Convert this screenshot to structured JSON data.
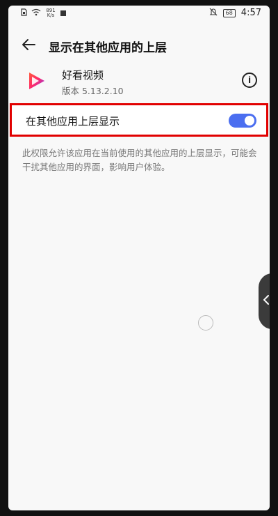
{
  "status_bar": {
    "net_speed_top": "891",
    "net_speed_bottom": "K/s",
    "battery": "68",
    "time": "4:57"
  },
  "header": {
    "title": "显示在其他应用的上层"
  },
  "app": {
    "name": "好看视频",
    "version": "版本 5.13.2.10"
  },
  "setting": {
    "label": "在其他应用上层显示",
    "toggle_on": true
  },
  "description": "此权限允许该应用在当前使用的其他应用的上层显示，可能会干扰其他应用的界面，影响用户体验。",
  "colors": {
    "toggle_on": "#4b6ef0",
    "highlight_border": "#e10000"
  }
}
